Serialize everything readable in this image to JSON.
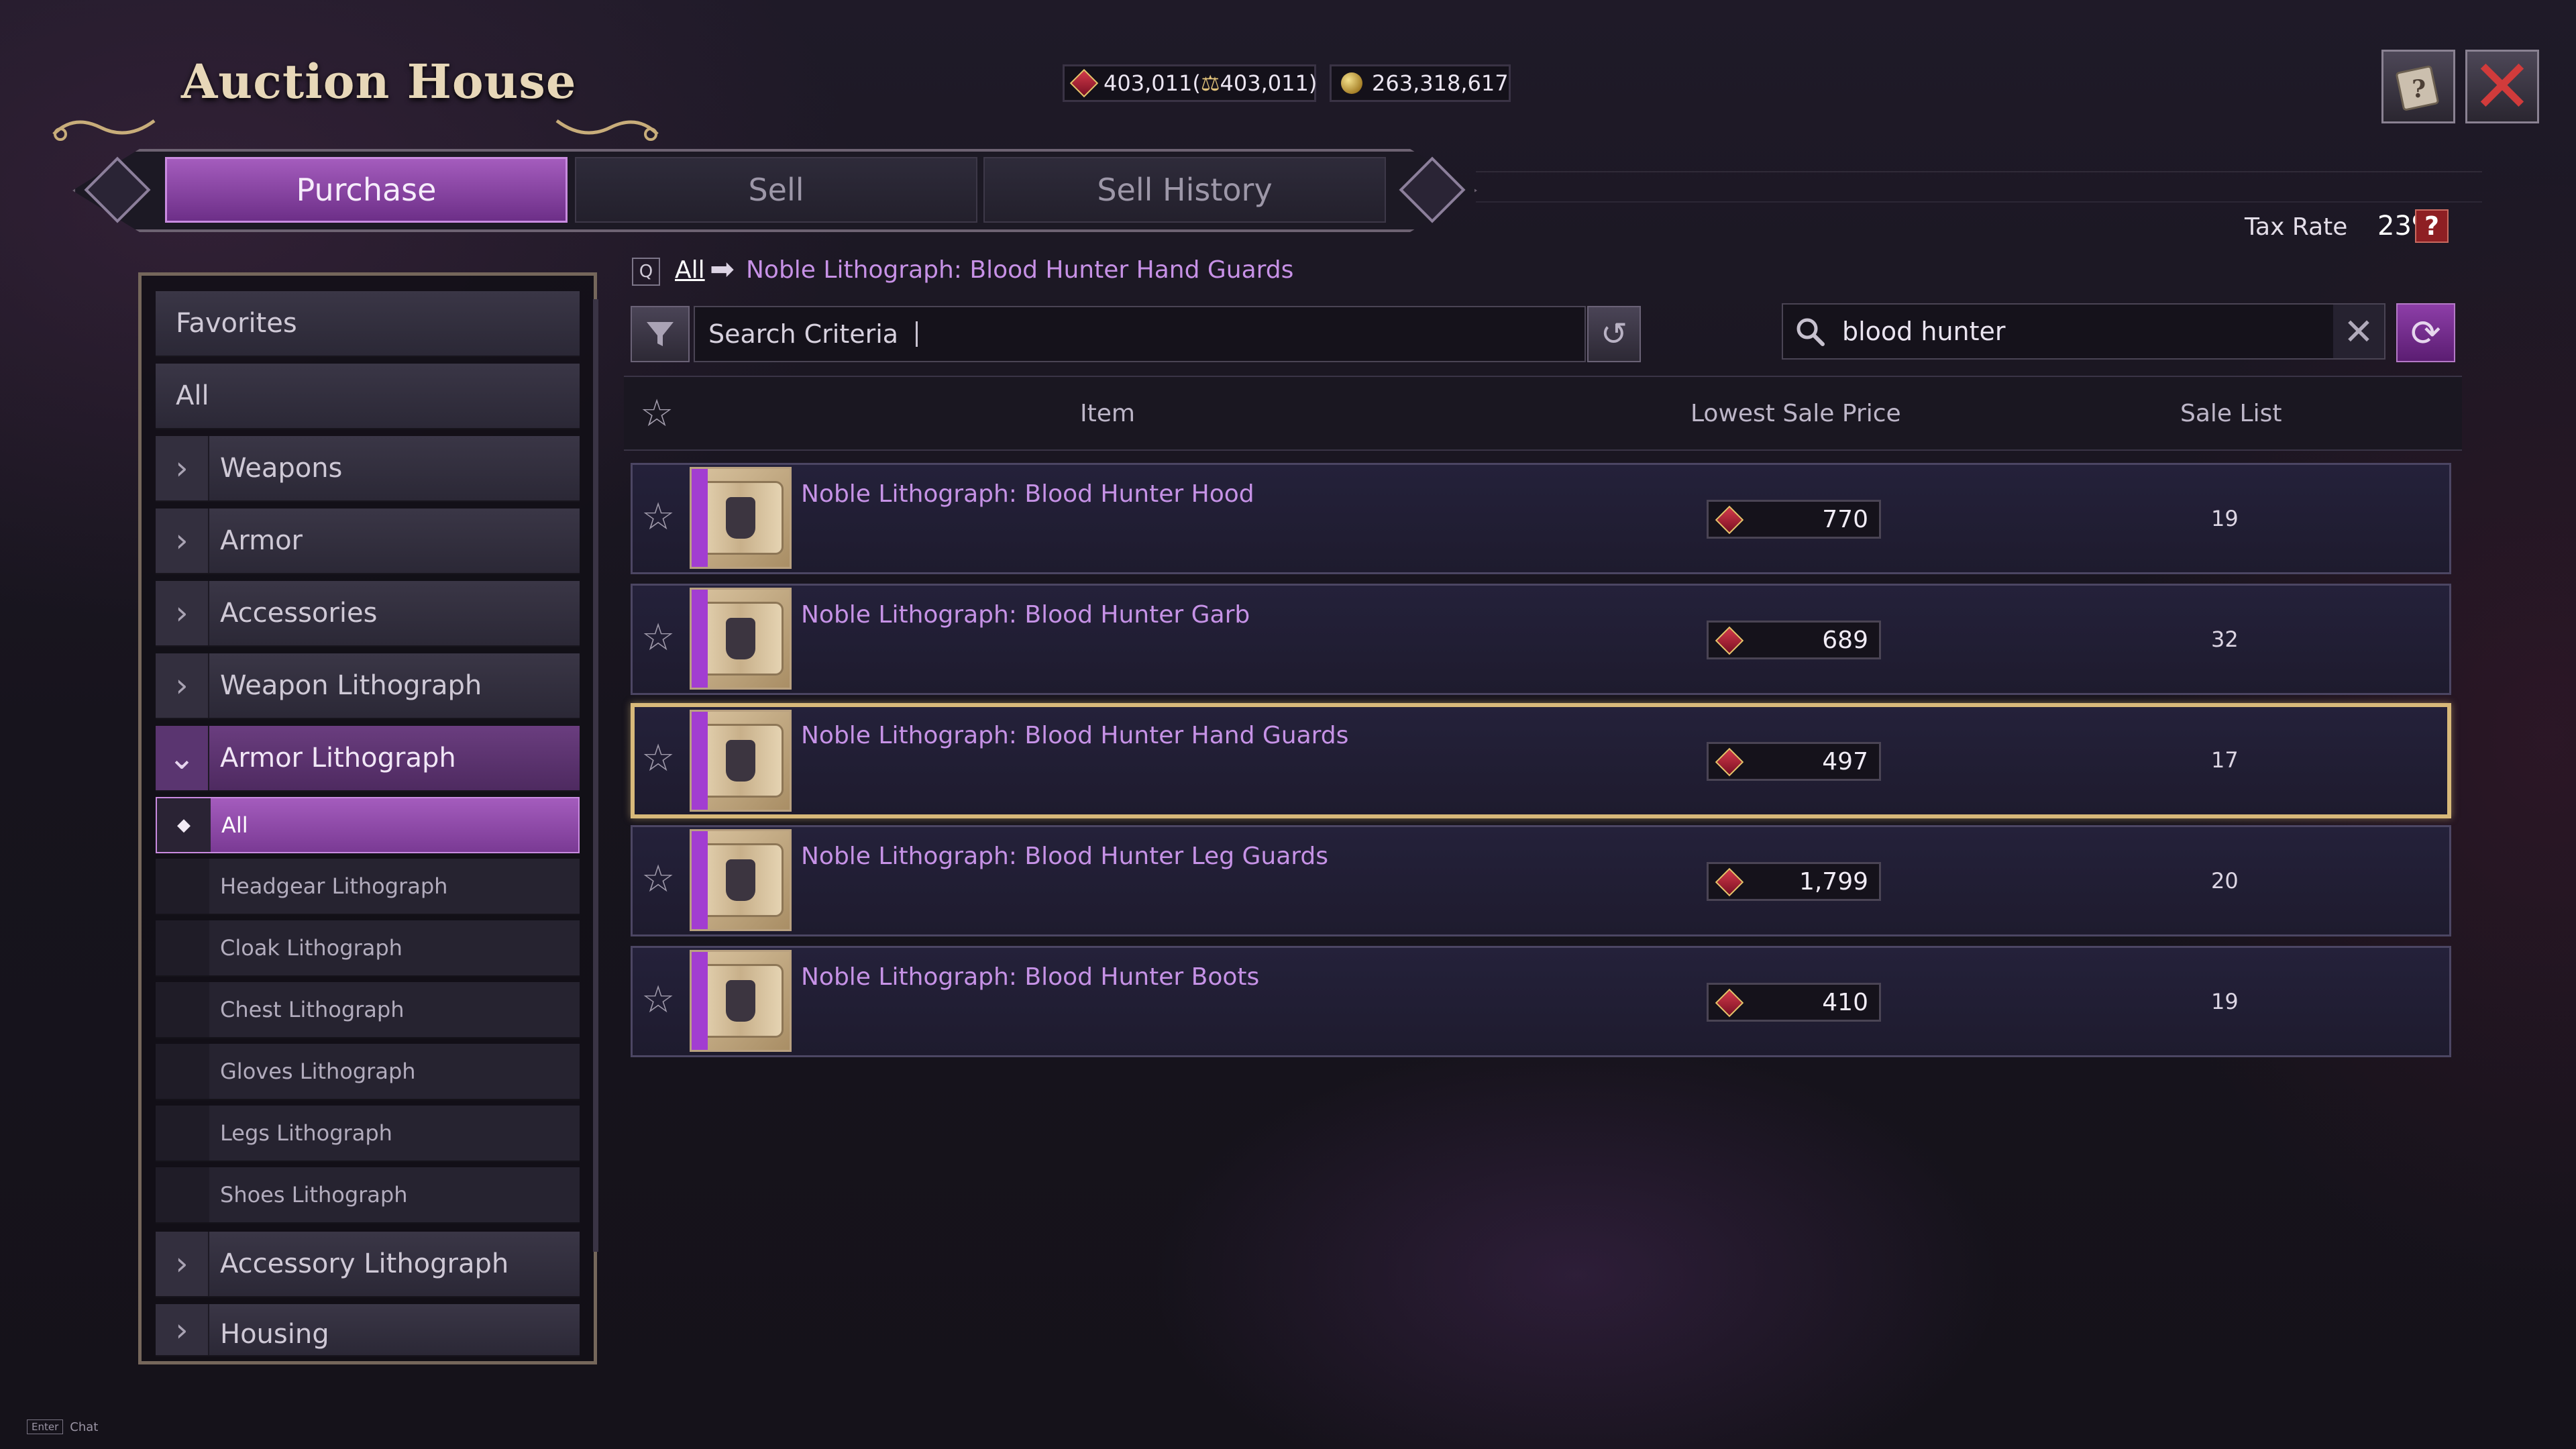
{
  "window": {
    "title": "Auction House",
    "currency_primary": "403,011(",
    "currency_primary_extra": "403,011)",
    "currency_secondary": "263,318,617"
  },
  "tabs": [
    {
      "label": "Purchase",
      "active": true
    },
    {
      "label": "Sell",
      "active": false
    },
    {
      "label": "Sell History",
      "active": false
    }
  ],
  "tax": {
    "label": "Tax Rate",
    "value": "23%",
    "help": "?"
  },
  "sidebar": {
    "items": [
      {
        "label": "Favorites",
        "type": "plain"
      },
      {
        "label": "All",
        "type": "plain"
      },
      {
        "label": "Weapons",
        "type": "expandable"
      },
      {
        "label": "Armor",
        "type": "expandable"
      },
      {
        "label": "Accessories",
        "type": "expandable"
      },
      {
        "label": "Weapon Lithograph",
        "type": "expandable"
      },
      {
        "label": "Armor Lithograph",
        "type": "expanded"
      }
    ],
    "subitems": [
      {
        "label": "All",
        "active": true
      },
      {
        "label": "Headgear Lithograph"
      },
      {
        "label": "Cloak Lithograph"
      },
      {
        "label": "Chest Lithograph"
      },
      {
        "label": "Gloves Lithograph"
      },
      {
        "label": "Legs Lithograph"
      },
      {
        "label": "Shoes Lithograph"
      }
    ],
    "items_after": [
      {
        "label": "Accessory Lithograph",
        "type": "expandable"
      },
      {
        "label": "Housing",
        "type": "expandable"
      }
    ]
  },
  "breadcrumb": {
    "q": "Q",
    "root": "All",
    "current": "Noble Lithograph: Blood Hunter Hand Guards"
  },
  "search": {
    "criteria_placeholder": "Search Criteria",
    "query": "blood hunter"
  },
  "table": {
    "headers": {
      "item": "Item",
      "price": "Lowest Sale Price",
      "sale_list": "Sale List"
    },
    "rows": [
      {
        "name": "Noble Lithograph: Blood Hunter Hood",
        "price": "770",
        "sale_list": "19",
        "selected": false
      },
      {
        "name": "Noble Lithograph: Blood Hunter Garb",
        "price": "689",
        "sale_list": "32",
        "selected": false
      },
      {
        "name": "Noble Lithograph: Blood Hunter Hand Guards",
        "price": "497",
        "sale_list": "17",
        "selected": true
      },
      {
        "name": "Noble Lithograph: Blood Hunter Leg Guards",
        "price": "1,799",
        "sale_list": "20",
        "selected": false
      },
      {
        "name": "Noble Lithograph: Blood Hunter Boots",
        "price": "410",
        "sale_list": "19",
        "selected": false
      }
    ]
  },
  "footer": {
    "key": "Enter",
    "action": "Chat"
  },
  "colors": {
    "accent_purple": "#a45cbd",
    "item_name": "#c692e6",
    "highlight": "#d8b97a",
    "close_red": "#d13b3b"
  },
  "icons": {
    "close": "close-icon",
    "help": "help-book-icon",
    "filter": "filter-icon",
    "search": "search-icon",
    "refresh": "refresh-icon",
    "undo": "undo-icon"
  }
}
